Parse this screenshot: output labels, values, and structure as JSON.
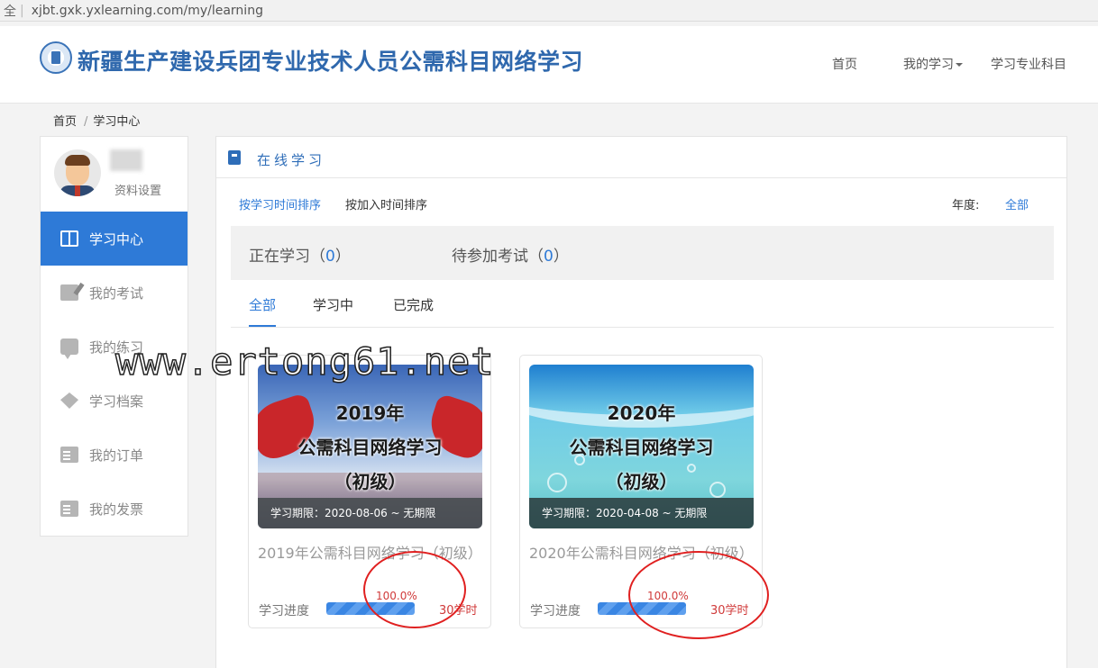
{
  "browser": {
    "security_label": "全",
    "url": "xjbt.gxk.yxlearning.com/my/learning"
  },
  "header": {
    "site_title": "新疆生产建设兵团专业技术人员公需科目网络学习",
    "nav": [
      {
        "label": "首页"
      },
      {
        "label": "我的学习"
      },
      {
        "label": "学习专业科目"
      }
    ]
  },
  "breadcrumb": {
    "home": "首页",
    "current": "学习中心"
  },
  "sidebar": {
    "profile_settings": "资料设置",
    "items": [
      {
        "label": "学习中心",
        "icon": "book-icon",
        "active": true
      },
      {
        "label": "我的考试",
        "icon": "edit-icon"
      },
      {
        "label": "我的练习",
        "icon": "chat-icon"
      },
      {
        "label": "学习档案",
        "icon": "graduation-cap-icon"
      },
      {
        "label": "我的订单",
        "icon": "document-icon"
      },
      {
        "label": "我的发票",
        "icon": "document-icon"
      }
    ]
  },
  "main": {
    "panel_title": "在线学习",
    "sort": {
      "by_study_time": "按学习时间排序",
      "by_join_time": "按加入时间排序"
    },
    "year": {
      "label": "年度:",
      "value": "全部"
    },
    "stats": [
      {
        "label": "正在学习（",
        "count": "0",
        "close": "）"
      },
      {
        "label": "待参加考试（",
        "count": "0",
        "close": "）"
      }
    ],
    "tabs": [
      {
        "label": "全部",
        "active": true
      },
      {
        "label": "学习中"
      },
      {
        "label": "已完成"
      }
    ],
    "courses": [
      {
        "cover_line1": "2019年",
        "cover_line2": "公需科目网络学习",
        "cover_line3": "（初级）",
        "period": "学习期限：2020-08-06 ~ 无期限",
        "name": "2019年公需科目网络学习（初级）",
        "progress_label": "学习进度",
        "progress": "100.0%",
        "progress_fraction": 1.0,
        "hours": "30学时"
      },
      {
        "cover_line1": "2020年",
        "cover_line2": "公需科目网络学习",
        "cover_line3": "（初级）",
        "period": "学习期限：2020-04-08 ~ 无期限",
        "name": "2020年公需科目网络学习（初级）",
        "progress_label": "学习进度",
        "progress": "100.0%",
        "progress_fraction": 1.0,
        "hours": "30学时"
      }
    ]
  },
  "watermark": "www.ertong61.net",
  "colors": {
    "accent": "#2e7ad7",
    "title_blue": "#2f68ad",
    "progress_red": "#d03a3a",
    "annotation_red": "#e02020"
  }
}
